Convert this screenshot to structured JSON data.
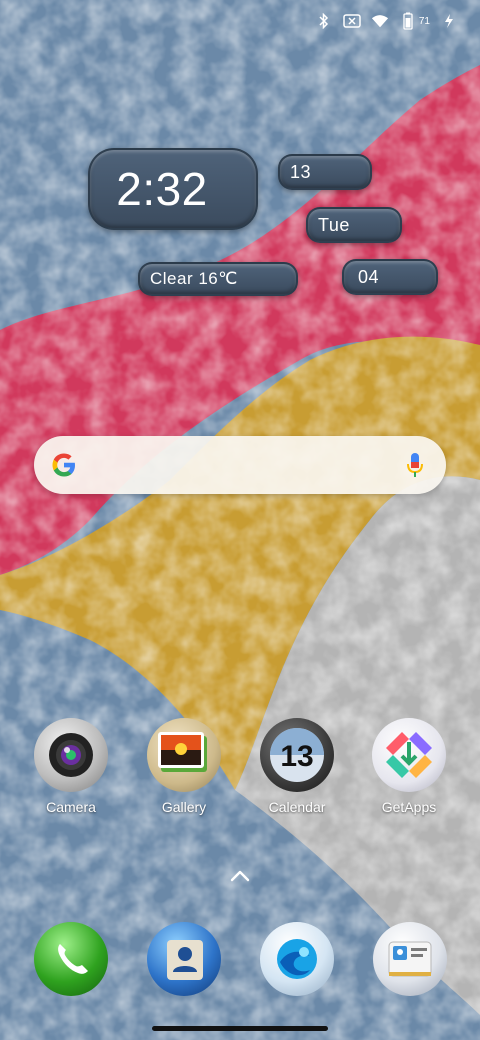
{
  "status_bar": {
    "icons": [
      "bluetooth-icon",
      "no-sim-icon",
      "wifi-icon",
      "battery-icon",
      "charging-icon"
    ],
    "battery_level": "71"
  },
  "widget": {
    "time": "2:32",
    "date": "13",
    "day": "Tue",
    "weather": "Clear  16℃",
    "month": "04"
  },
  "search": {
    "logo": "google-logo",
    "mic": "mic-icon"
  },
  "apps": [
    {
      "label": "Camera",
      "icon": "camera-icon"
    },
    {
      "label": "Gallery",
      "icon": "gallery-icon"
    },
    {
      "label": "Calendar",
      "icon": "calendar-icon",
      "badge": "13"
    },
    {
      "label": "GetApps",
      "icon": "getapps-icon"
    }
  ],
  "dock": [
    {
      "icon": "phone-icon"
    },
    {
      "icon": "contacts-icon"
    },
    {
      "icon": "browser-icon"
    },
    {
      "icon": "messages-icon"
    }
  ],
  "colors": {
    "blue": "#6f8eae",
    "red": "#d5385b",
    "gold": "#c9a032",
    "grey": "#b5b5b5",
    "widget": "#435468"
  }
}
